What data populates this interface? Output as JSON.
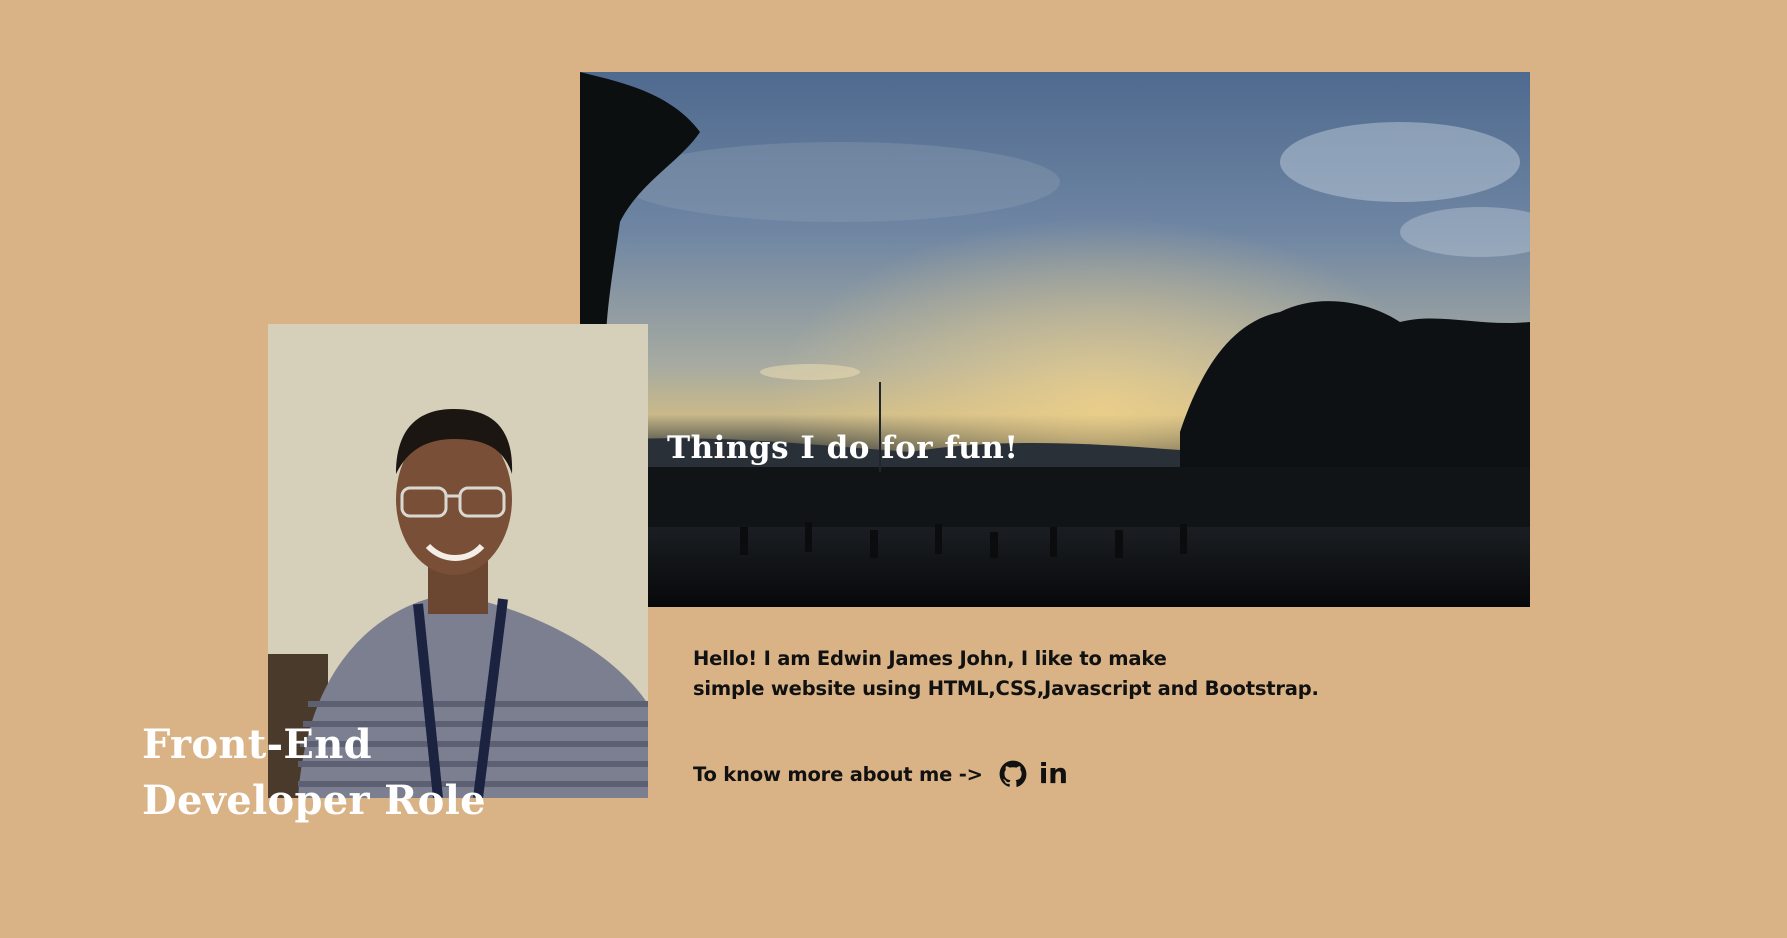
{
  "hero": {
    "title": "Things I do for fun!",
    "image_description_icon": "landscape-sunset-photo"
  },
  "profile": {
    "role_line1": "Front-End",
    "role_line2": "Developer Role",
    "photo_icon": "portrait-photo"
  },
  "intro": {
    "line1": "Hello! I am Edwin James John, I like to make",
    "line2": "simple website using HTML,CSS,Javascript and Bootstrap."
  },
  "links": {
    "label": "To know more about me ->",
    "github_icon": "github-icon",
    "linkedin_text": "in"
  },
  "colors": {
    "background": "#d9b386",
    "text_dark": "#111111",
    "text_light": "#ffffff"
  }
}
